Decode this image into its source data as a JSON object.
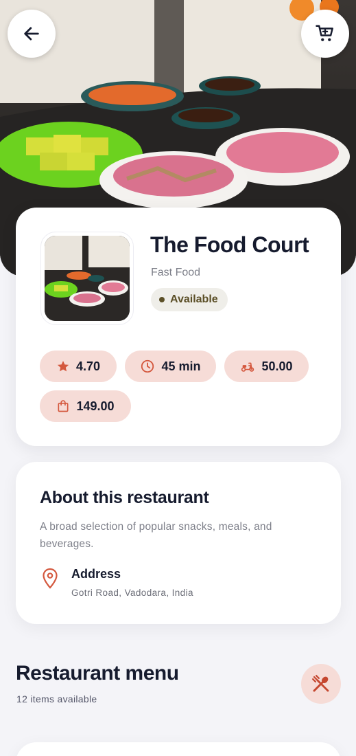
{
  "restaurant": {
    "name": "The Food Court",
    "category": "Fast Food",
    "status": "Available",
    "stats": {
      "rating": "4.70",
      "delivery_time": "45 min",
      "delivery_fee": "50.00",
      "min_order": "149.00"
    }
  },
  "about": {
    "title": "About this restaurant",
    "description": "A broad selection of popular snacks, meals, and beverages.",
    "address_label": "Address",
    "address_value": "Gotri Road, Vadodara, India"
  },
  "menu": {
    "title": "Restaurant menu",
    "count_text": "12 items available"
  },
  "icons": {
    "back": "arrow-left-icon",
    "cart": "shopping-cart-icon",
    "rating": "star-icon",
    "time": "clock-icon",
    "delivery": "scooter-icon",
    "min_order": "shopping-bag-icon",
    "address": "map-pin-icon",
    "menu": "utensils-icon"
  },
  "colors": {
    "accent": "#d4583e",
    "pill_background": "#f6dcd7",
    "status_text": "#5b4f27",
    "heading": "#161b2e"
  }
}
